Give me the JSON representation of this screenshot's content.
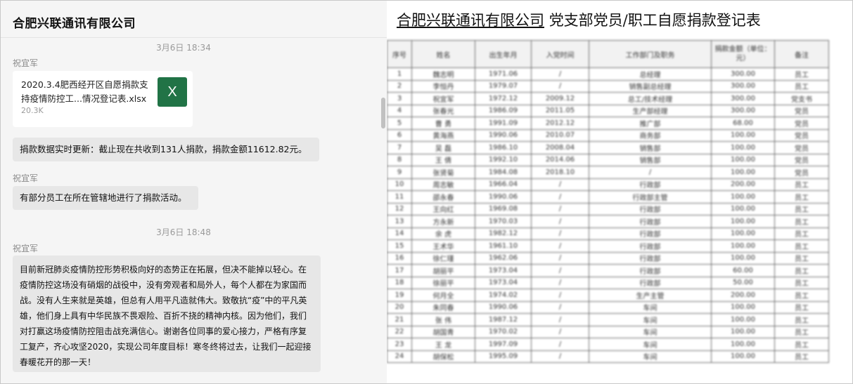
{
  "chat": {
    "title": "合肥兴联通讯有限公司",
    "timestamp_1": "3月6日 18:34",
    "sender_1": "祝宜军",
    "file": {
      "name": "2020.3.4肥西经开区自愿捐款支持疫情防控工...情况登记表.xlsx",
      "size": "20.3K",
      "icon": "excel-icon",
      "icon_letter": "X",
      "icon_color": "#217346"
    },
    "message_1": "捐款数据实时更新：截止现在共收到131人捐款，捐款金额11612.82元。",
    "sender_2": "祝宜军",
    "message_2": "有部分员工在所在管辖地进行了捐款活动。",
    "timestamp_2": "3月6日 18:48",
    "sender_3": "祝宜军",
    "message_3": "目前新冠肺炎疫情防控形势积极向好的态势正在拓展，但决不能掉以轻心。在疫情防控这场没有硝烟的战役中，没有旁观者和局外人，每个人都在为家国而战。没有人生来就是英雄，但总有人用平凡造就伟大。致敬抗“疫”中的平凡英雄，他们身上具有中华民族不畏艰险、百折不挠的精神内核。因为他们，我们对打赢这场疫情防控阻击战充满信心。谢谢各位同事的爱心接力，严格有序复工复产，齐心攻坚2020，实现公司年度目标！寒冬终将过去，让我们一起迎接春暖花开的那一天！"
  },
  "sheet": {
    "title_company": "合肥兴联通讯有限公司",
    "title_rest": "党支部党员/职工自愿捐款登记表",
    "headers": [
      "序号",
      "姓名",
      "出生年月",
      "入党时间",
      "工作部门及职务",
      "捐款金额（单位：元）",
      "备注"
    ],
    "rows": [
      [
        "1",
        "魏志明",
        "1971.06",
        "/",
        "总经理",
        "300.00",
        "员工"
      ],
      [
        "2",
        "李恒丹",
        "1979.07",
        "/",
        "销售副总经理",
        "300.00",
        "员工"
      ],
      [
        "3",
        "祝宜军",
        "1972.12",
        "2009.12",
        "总工/技术经理",
        "300.00",
        "党支书"
      ],
      [
        "4",
        "张春光",
        "1986.09",
        "2011.05",
        "生产部经理",
        "300.00",
        "党员"
      ],
      [
        "5",
        "曹  勇",
        "1991.09",
        "2012.12",
        "推广部",
        "68.00",
        "党员"
      ],
      [
        "6",
        "黄海燕",
        "1990.06",
        "2010.07",
        "商务部",
        "100.00",
        "党员"
      ],
      [
        "7",
        "吴  磊",
        "1986.10",
        "2008.04",
        "销售部",
        "100.00",
        "党员"
      ],
      [
        "8",
        "王  倩",
        "1992.10",
        "2014.06",
        "销售部",
        "100.00",
        "党员"
      ],
      [
        "9",
        "张贤菊",
        "1984.08",
        "2018.10",
        "/",
        "100.00",
        "党员"
      ],
      [
        "10",
        "周志敏",
        "1966.04",
        "/",
        "行政部",
        "200.00",
        "员工"
      ],
      [
        "11",
        "邵永春",
        "1990.06",
        "/",
        "行政部主管",
        "100.00",
        "员工"
      ],
      [
        "12",
        "王向红",
        "1969.08",
        "/",
        "行政部",
        "100.00",
        "员工"
      ],
      [
        "13",
        "方永新",
        "1970.03",
        "/",
        "行政部",
        "100.00",
        "员工"
      ],
      [
        "14",
        "余  虎",
        "1982.12",
        "/",
        "行政部",
        "100.00",
        "员工"
      ],
      [
        "15",
        "王术华",
        "1961.10",
        "/",
        "行政部",
        "100.00",
        "员工"
      ],
      [
        "16",
        "徐仁瑾",
        "1962.06",
        "/",
        "行政部",
        "100.00",
        "员工"
      ],
      [
        "17",
        "胡丽平",
        "1973.04",
        "/",
        "行政部",
        "60.00",
        "员工"
      ],
      [
        "18",
        "徐丽平",
        "1973.04",
        "/",
        "行政部",
        "50.00",
        "员工"
      ],
      [
        "19",
        "何月全",
        "1974.02",
        "/",
        "生产主管",
        "200.00",
        "员工"
      ],
      [
        "20",
        "朱同春",
        "1990.06",
        "/",
        "车间",
        "100.00",
        "员工"
      ],
      [
        "21",
        "张  伟",
        "1987.12",
        "/",
        "车间",
        "100.00",
        "员工"
      ],
      [
        "22",
        "胡国青",
        "1970.02",
        "/",
        "车间",
        "100.00",
        "员工"
      ],
      [
        "23",
        "王  龙",
        "1997.09",
        "/",
        "车间",
        "100.00",
        "员工"
      ],
      [
        "24",
        "胡保松",
        "1995.09",
        "/",
        "车间",
        "100.00",
        "员工"
      ]
    ]
  }
}
